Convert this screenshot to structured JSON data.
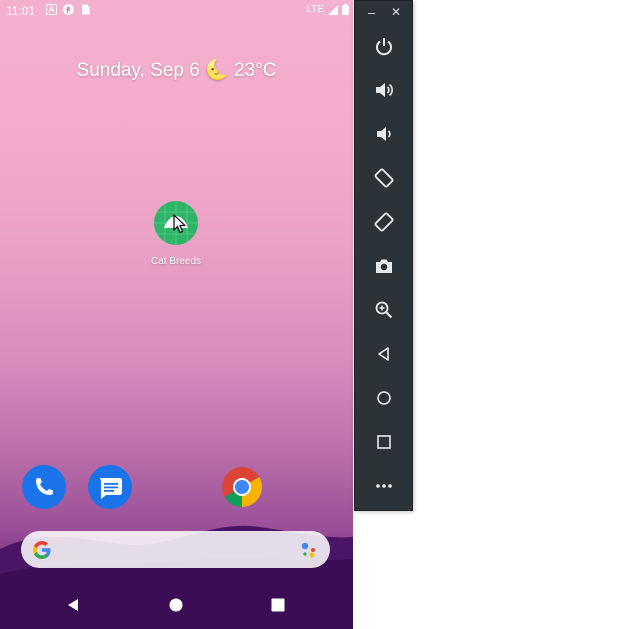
{
  "status_bar": {
    "time": "11:01",
    "network": "LTE",
    "left_icons": [
      "text-a-icon",
      "f-circle-icon",
      "sim-card-icon"
    ],
    "right_icons": [
      "signal-icon",
      "battery-icon"
    ]
  },
  "home": {
    "date_weather": "Sunday, Sep 6 🌜 23°C",
    "app": {
      "label": "Cat Breeds",
      "icon": "cat-breeds-app-icon"
    },
    "dock": [
      "phone-icon",
      "messages-icon",
      "chrome-icon"
    ],
    "search_bar": {
      "left_icon": "google-g-icon",
      "right_icon": "assistant-icon"
    }
  },
  "nav": [
    "back-icon",
    "home-icon",
    "recents-icon"
  ],
  "emulator_panel": {
    "window_controls": [
      "minimize-icon",
      "close-icon"
    ],
    "minimize_glyph": "–",
    "close_glyph": "✕",
    "buttons": [
      "power-icon",
      "volume-up-icon",
      "volume-down-icon",
      "rotate-left-icon",
      "rotate-right-icon",
      "camera-icon",
      "zoom-icon",
      "back-icon",
      "home-icon",
      "overview-icon",
      "more-icon"
    ]
  },
  "colors": {
    "wallpaper_top": "#f4b1cf",
    "wallpaper_bottom": "#3b0d55",
    "panel_bg": "#2c3338",
    "app_icon_green": "#2fb56a",
    "phone_blue": "#1a73e8"
  }
}
